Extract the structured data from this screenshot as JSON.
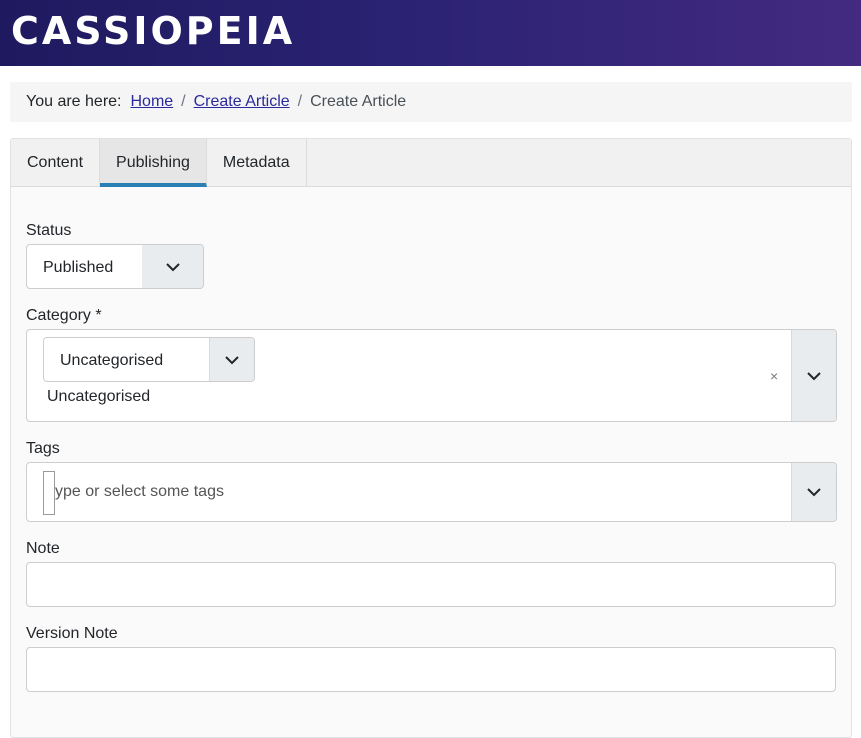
{
  "site": {
    "brand": "CASSIOPEIA"
  },
  "breadcrumb": {
    "prefix": "You are here:",
    "items": [
      {
        "label": "Home",
        "link": true
      },
      {
        "label": "Create Article",
        "link": true
      },
      {
        "label": "Create Article",
        "link": false
      }
    ],
    "separator": "/"
  },
  "tabs": [
    {
      "label": "Content",
      "active": false
    },
    {
      "label": "Publishing",
      "active": true
    },
    {
      "label": "Metadata",
      "active": false
    }
  ],
  "form": {
    "status": {
      "label": "Status",
      "value": "Published"
    },
    "category": {
      "label": "Category *",
      "select_value": "Uncategorised",
      "selected_item": "Uncategorised",
      "clear_symbol": "×"
    },
    "tags": {
      "label": "Tags",
      "placeholder": "ype or select some tags"
    },
    "note": {
      "label": "Note",
      "value": ""
    },
    "version_note": {
      "label": "Version Note",
      "value": ""
    }
  },
  "colors": {
    "header_start": "#1f1a5f",
    "header_end": "#432a80",
    "tab_accent": "#2a7fb5",
    "link": "#2a2a9c"
  },
  "icons": {
    "dropdown": "chevron-down-icon"
  }
}
